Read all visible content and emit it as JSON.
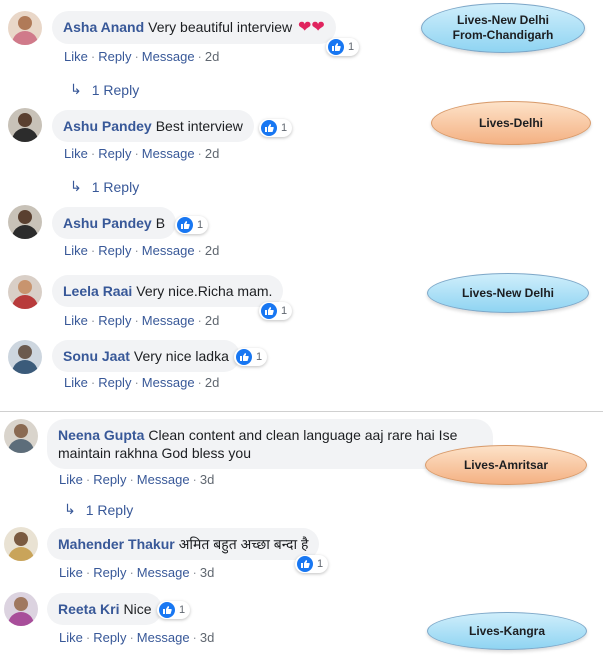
{
  "comments": [
    {
      "author": "Asha Anand",
      "text": "Very beautiful interview",
      "emoji": "❤❤",
      "reactions": "1",
      "actions": {
        "like": "Like",
        "reply": "Reply",
        "message": "Message",
        "time": "2d"
      },
      "replies": "1 Reply"
    },
    {
      "author": "Ashu Pandey",
      "text": "Best interview",
      "reactions": "1",
      "actions": {
        "like": "Like",
        "reply": "Reply",
        "message": "Message",
        "time": "2d"
      },
      "replies": "1 Reply"
    },
    {
      "author": "Ashu Pandey",
      "text": "B",
      "reactions": "1",
      "actions": {
        "like": "Like",
        "reply": "Reply",
        "message": "Message",
        "time": "2d"
      }
    },
    {
      "author": "Leela Raai",
      "text": "Very nice.Richa mam.",
      "reactions": "1",
      "actions": {
        "like": "Like",
        "reply": "Reply",
        "message": "Message",
        "time": "2d"
      }
    },
    {
      "author": "Sonu Jaat",
      "text": "Very nice ladka",
      "reactions": "1",
      "actions": {
        "like": "Like",
        "reply": "Reply",
        "message": "Message",
        "time": "2d"
      }
    },
    {
      "author": "Neena Gupta",
      "text": "Clean content and clean language aaj rare hai Ise maintain rakhna God bless you",
      "actions": {
        "like": "Like",
        "reply": "Reply",
        "message": "Message",
        "time": "3d"
      },
      "replies": "1 Reply"
    },
    {
      "author": "Mahender Thakur",
      "text": "अमित बहुत अच्छा बन्दा है",
      "reactions": "1",
      "actions": {
        "like": "Like",
        "reply": "Reply",
        "message": "Message",
        "time": "3d"
      }
    },
    {
      "author": "Reeta Kri",
      "text": "Nice",
      "reactions": "1",
      "actions": {
        "like": "Like",
        "reply": "Reply",
        "message": "Message",
        "time": "3d"
      }
    }
  ],
  "tags": {
    "t1": "Lives-New Delhi From-Chandigarh",
    "t2": "Lives-Delhi",
    "t3": "Lives-New Delhi",
    "t4": "Lives-Amritsar",
    "t5": "Lives-Kangra"
  },
  "colors": {
    "author": "#385898",
    "bubble": "#f2f3f5",
    "like": "#1877f2",
    "tag_blue": "#8fd4f2",
    "tag_orange": "#f4b183"
  }
}
